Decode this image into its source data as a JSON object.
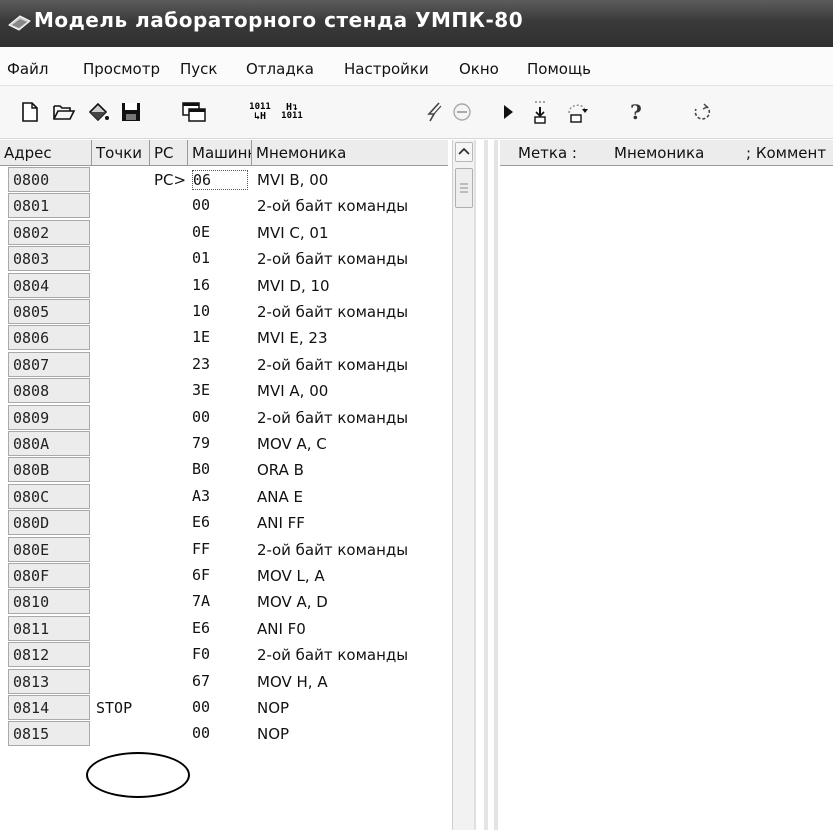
{
  "window": {
    "title": "Модель лабораторного стенда УМПК-80"
  },
  "menu": [
    "Файл",
    "Просмотр",
    "Пуск",
    "Отладка",
    "Настройки",
    "Окно",
    "Помощь"
  ],
  "toolbar_icons": [
    "new-file-icon",
    "open-folder-icon",
    "paint-bucket-icon",
    "save-icon",
    "windows-icon",
    "hex-convert-icon",
    "decimal-convert-icon",
    "lightning-icon",
    "stop-circle-icon",
    "run-icon",
    "step-into-icon",
    "step-over-icon",
    "help-icon",
    "reset-icon"
  ],
  "toolbar_text": {
    "hex_top": "1011",
    "hex_bottom": "↳H",
    "dec_top": "H↴",
    "dec_bottom": "1011"
  },
  "table": {
    "headers": {
      "address": "Адрес",
      "breakpoints": "Точки",
      "pc": "PC",
      "machine_code": "Машинн",
      "mnemonic": "Мнемоника"
    },
    "rows": [
      {
        "addr": "0800",
        "point": "",
        "pc": "PC>",
        "code": "06",
        "mnem": "MVI  B, 00"
      },
      {
        "addr": "0801",
        "point": "",
        "pc": "",
        "code": "00",
        "mnem": "2-ой байт команды"
      },
      {
        "addr": "0802",
        "point": "",
        "pc": "",
        "code": "0E",
        "mnem": "MVI  C, 01"
      },
      {
        "addr": "0803",
        "point": "",
        "pc": "",
        "code": "01",
        "mnem": "2-ой байт команды"
      },
      {
        "addr": "0804",
        "point": "",
        "pc": "",
        "code": "16",
        "mnem": "MVI  D, 10"
      },
      {
        "addr": "0805",
        "point": "",
        "pc": "",
        "code": "10",
        "mnem": "2-ой байт команды"
      },
      {
        "addr": "0806",
        "point": "",
        "pc": "",
        "code": "1E",
        "mnem": "MVI  E, 23"
      },
      {
        "addr": "0807",
        "point": "",
        "pc": "",
        "code": "23",
        "mnem": "2-ой байт команды"
      },
      {
        "addr": "0808",
        "point": "",
        "pc": "",
        "code": "3E",
        "mnem": "MVI  A, 00"
      },
      {
        "addr": "0809",
        "point": "",
        "pc": "",
        "code": "00",
        "mnem": "2-ой байт команды"
      },
      {
        "addr": "080A",
        "point": "",
        "pc": "",
        "code": "79",
        "mnem": "MOV  A, C"
      },
      {
        "addr": "080B",
        "point": "",
        "pc": "",
        "code": "B0",
        "mnem": "ORA  B"
      },
      {
        "addr": "080C",
        "point": "",
        "pc": "",
        "code": "A3",
        "mnem": "ANA  E"
      },
      {
        "addr": "080D",
        "point": "",
        "pc": "",
        "code": "E6",
        "mnem": "ANI  FF"
      },
      {
        "addr": "080E",
        "point": "",
        "pc": "",
        "code": "FF",
        "mnem": "2-ой байт команды"
      },
      {
        "addr": "080F",
        "point": "",
        "pc": "",
        "code": "6F",
        "mnem": "MOV  L, A"
      },
      {
        "addr": "0810",
        "point": "",
        "pc": "",
        "code": "7A",
        "mnem": "MOV  A, D"
      },
      {
        "addr": "0811",
        "point": "",
        "pc": "",
        "code": "E6",
        "mnem": "ANI  F0"
      },
      {
        "addr": "0812",
        "point": "",
        "pc": "",
        "code": "F0",
        "mnem": "2-ой байт команды"
      },
      {
        "addr": "0813",
        "point": "",
        "pc": "",
        "code": "67",
        "mnem": "MOV  H, A"
      },
      {
        "addr": "0814",
        "point": "STOP",
        "pc": "",
        "code": "00",
        "mnem": "NOP"
      },
      {
        "addr": "0815",
        "point": "",
        "pc": "",
        "code": "00",
        "mnem": "NOP"
      }
    ]
  },
  "right_panel": {
    "headers": {
      "label": "Метка :",
      "mnemonic": "Мнемоника",
      "comment": "; Коммент"
    }
  }
}
